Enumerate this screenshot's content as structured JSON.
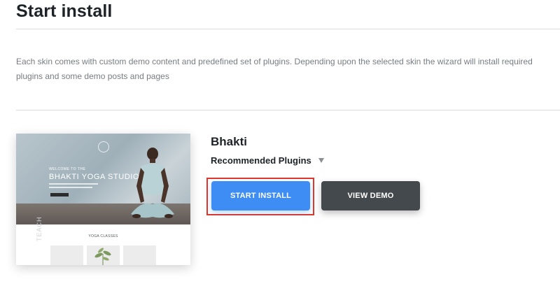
{
  "page": {
    "title": "Start install",
    "description": "Each skin comes with custom demo content and predefined set of plugins. Depending upon the selected skin the wizard will install required plugins and some demo posts and pages"
  },
  "skin": {
    "name": "Bhakti",
    "plugins_label": "Recommended Plugins",
    "thumbnail": {
      "welcome": "WELCOME TO THE",
      "studio": "BHAKTI YOGA STUDIO",
      "section": "YOGA CLASSES",
      "vertical": "TEACH"
    }
  },
  "buttons": {
    "install": "START INSTALL",
    "demo": "VIEW DEMO"
  },
  "colors": {
    "install_bg": "#3d8df5",
    "demo_bg": "#44494e",
    "highlight": "#e0362b"
  }
}
